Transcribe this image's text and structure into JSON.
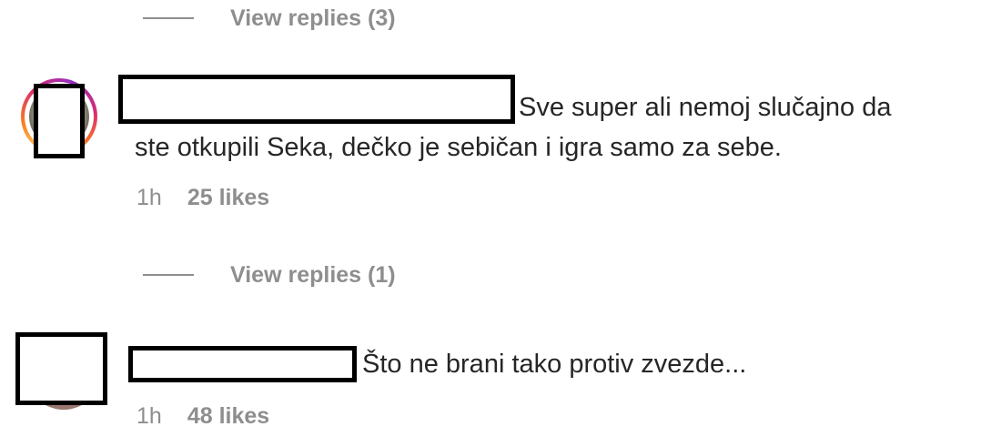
{
  "thread_top": {
    "view_replies_label": "View replies (3)"
  },
  "comments": [
    {
      "text_line1": "Sve super ali nemoj slučajno da",
      "text_line2": "ste otkupili Seka, dečko je sebičan i igra samo za sebe.",
      "time": "1h",
      "likes": "25 likes",
      "view_replies_label": "View replies (1)",
      "avatar_icon": "user-avatar-story-ring"
    },
    {
      "text_line1": "Što ne brani tako protiv zvezde...",
      "time": "1h",
      "likes": "48 likes",
      "avatar_icon": "user-avatar"
    }
  ],
  "colors": {
    "text": "#262626",
    "secondary": "#8e8e8e",
    "redaction_border": "#000000",
    "story_ring_start": "#feda75",
    "story_ring_end": "#d62976"
  }
}
